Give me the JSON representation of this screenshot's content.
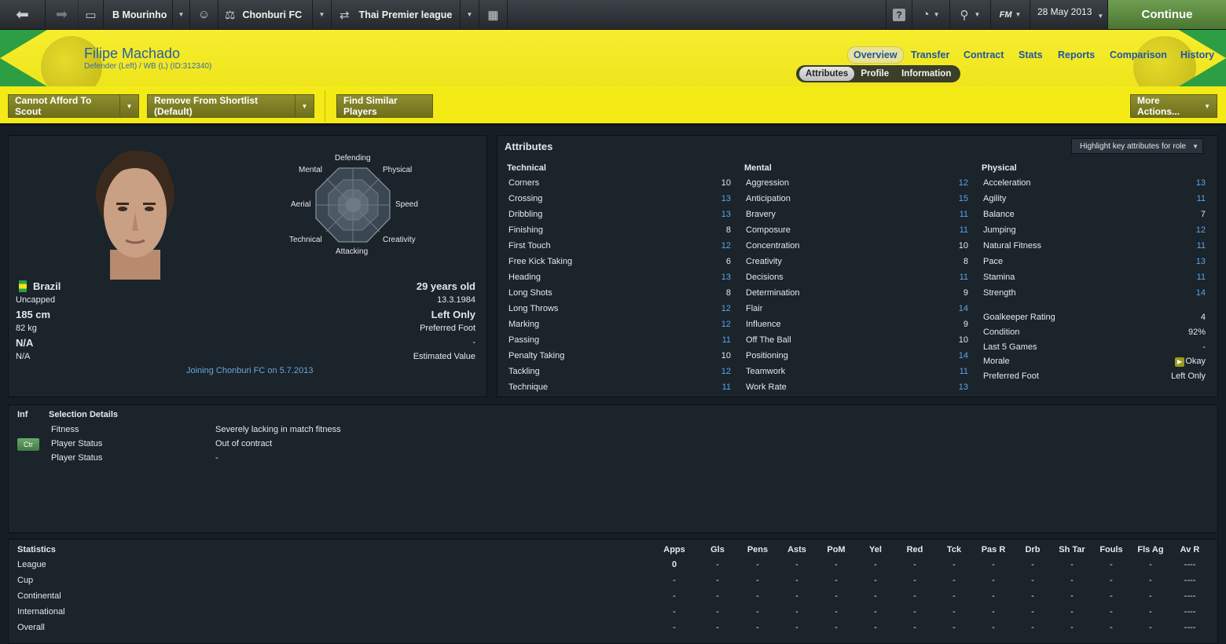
{
  "topbar": {
    "manager": "B Mourinho",
    "club": "Chonburi FC",
    "league": "Thai Premier league",
    "date": "28 May 2013",
    "continue_label": "Continue",
    "fm_label": "FM"
  },
  "player": {
    "name": "Filipe Machado",
    "position": "Defender (Left) / WB (L) (ID:312340)"
  },
  "nav": {
    "tabs": [
      "Overview",
      "Transfer",
      "Contract",
      "Stats",
      "Reports",
      "Comparison",
      "History"
    ],
    "subtabs": [
      "Attributes",
      "Profile",
      "Information"
    ]
  },
  "actions": {
    "scout": "Cannot Afford To Scout",
    "shortlist": "Remove From Shortlist (Default)",
    "similar": "Find Similar Players",
    "more": "More Actions..."
  },
  "radar": {
    "labels": [
      "Defending",
      "Physical",
      "Speed",
      "Creativity",
      "Attacking",
      "Technical",
      "Aerial",
      "Mental"
    ]
  },
  "profile": {
    "nation": "Brazil",
    "caps": "Uncapped",
    "height": "185 cm",
    "weight": "82 kg",
    "na1": "N/A",
    "na2": "N/A",
    "age": "29 years old",
    "dob": "13.3.1984",
    "foot": "Left Only",
    "foot_label": "Preferred Foot",
    "value": "-",
    "value_label": "Estimated Value",
    "joining": "Joining Chonburi FC on 5.7.2013"
  },
  "attributes": {
    "title": "Attributes",
    "highlight": "Highlight key attributes for role",
    "technical_title": "Technical",
    "mental_title": "Mental",
    "physical_title": "Physical",
    "technical": [
      {
        "name": "Corners",
        "value": "10"
      },
      {
        "name": "Crossing",
        "value": "13"
      },
      {
        "name": "Dribbling",
        "value": "13"
      },
      {
        "name": "Finishing",
        "value": "8"
      },
      {
        "name": "First Touch",
        "value": "12"
      },
      {
        "name": "Free Kick Taking",
        "value": "6"
      },
      {
        "name": "Heading",
        "value": "13"
      },
      {
        "name": "Long Shots",
        "value": "8"
      },
      {
        "name": "Long Throws",
        "value": "12"
      },
      {
        "name": "Marking",
        "value": "12"
      },
      {
        "name": "Passing",
        "value": "11"
      },
      {
        "name": "Penalty Taking",
        "value": "10"
      },
      {
        "name": "Tackling",
        "value": "12"
      },
      {
        "name": "Technique",
        "value": "11"
      }
    ],
    "mental": [
      {
        "name": "Aggression",
        "value": "12"
      },
      {
        "name": "Anticipation",
        "value": "15"
      },
      {
        "name": "Bravery",
        "value": "11"
      },
      {
        "name": "Composure",
        "value": "11"
      },
      {
        "name": "Concentration",
        "value": "10"
      },
      {
        "name": "Creativity",
        "value": "8"
      },
      {
        "name": "Decisions",
        "value": "11"
      },
      {
        "name": "Determination",
        "value": "9"
      },
      {
        "name": "Flair",
        "value": "14"
      },
      {
        "name": "Influence",
        "value": "9"
      },
      {
        "name": "Off The Ball",
        "value": "10"
      },
      {
        "name": "Positioning",
        "value": "14"
      },
      {
        "name": "Teamwork",
        "value": "11"
      },
      {
        "name": "Work Rate",
        "value": "13"
      }
    ],
    "physical": [
      {
        "name": "Acceleration",
        "value": "13"
      },
      {
        "name": "Agility",
        "value": "11"
      },
      {
        "name": "Balance",
        "value": "7"
      },
      {
        "name": "Jumping",
        "value": "12"
      },
      {
        "name": "Natural Fitness",
        "value": "11"
      },
      {
        "name": "Pace",
        "value": "13"
      },
      {
        "name": "Stamina",
        "value": "11"
      },
      {
        "name": "Strength",
        "value": "14"
      }
    ],
    "extra": [
      {
        "name": "Goalkeeper Rating",
        "value": "4"
      },
      {
        "name": "Condition",
        "value": "92%"
      },
      {
        "name": "Last 5 Games",
        "value": "-"
      },
      {
        "name": "Morale",
        "value": "Okay"
      },
      {
        "name": "Preferred Foot",
        "value": "Left Only"
      }
    ]
  },
  "selection": {
    "inf": "Inf",
    "title": "Selection Details",
    "badge": "Ctr",
    "rows": [
      {
        "label": "Fitness",
        "value": "Severely lacking in match fitness"
      },
      {
        "label": "Player Status",
        "value": "Out of contract"
      },
      {
        "label": "Player Status",
        "value": "-"
      }
    ]
  },
  "statistics": {
    "title": "Statistics",
    "columns": [
      "Apps",
      "Gls",
      "Pens",
      "Asts",
      "PoM",
      "Yel",
      "Red",
      "Tck",
      "Pas R",
      "Drb",
      "Sh Tar",
      "Fouls",
      "Fls Ag",
      "Av R"
    ],
    "rows": [
      {
        "label": "League",
        "values": [
          "0",
          "-",
          "-",
          "-",
          "-",
          "-",
          "-",
          "-",
          "-",
          "-",
          "-",
          "-",
          "-",
          "----"
        ]
      },
      {
        "label": "Cup",
        "values": [
          "-",
          "-",
          "-",
          "-",
          "-",
          "-",
          "-",
          "-",
          "-",
          "-",
          "-",
          "-",
          "-",
          "----"
        ]
      },
      {
        "label": "Continental",
        "values": [
          "-",
          "-",
          "-",
          "-",
          "-",
          "-",
          "-",
          "-",
          "-",
          "-",
          "-",
          "-",
          "-",
          "----"
        ]
      },
      {
        "label": "International",
        "values": [
          "-",
          "-",
          "-",
          "-",
          "-",
          "-",
          "-",
          "-",
          "-",
          "-",
          "-",
          "-",
          "-",
          "----"
        ]
      },
      {
        "label": "Overall",
        "values": [
          "-",
          "-",
          "-",
          "-",
          "-",
          "-",
          "-",
          "-",
          "-",
          "-",
          "-",
          "-",
          "-",
          "----"
        ]
      }
    ]
  },
  "colors": {
    "accent": "#f4ea16",
    "value_blue": "#5ba6e6",
    "continue_green": "#5e8a42"
  },
  "icons": [
    "back-icon",
    "forward-icon",
    "inbox-icon",
    "manager-icon",
    "club-icon",
    "competition-icon",
    "calendar-icon",
    "help-icon",
    "globe-icon",
    "search-icon"
  ]
}
